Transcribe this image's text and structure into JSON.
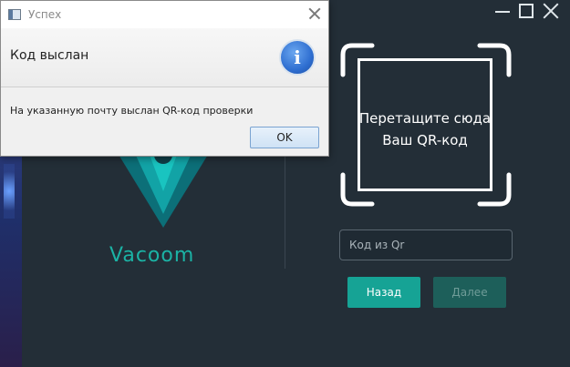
{
  "dialog": {
    "title": "Успех",
    "header": "Код выслан",
    "message": "На указанную почту выслан QR-код проверки",
    "ok_label": "OK",
    "icon": "info-icon"
  },
  "app": {
    "logo_text": "Vacoom",
    "qr_drop_line1": "Перетащите сюда",
    "qr_drop_line2": "Ваш QR-код",
    "code_input": {
      "value": "",
      "placeholder": "Код из Qr"
    },
    "back_label": "Назад",
    "next_label": "Далее"
  },
  "colors": {
    "accent": "#16a395",
    "background": "#232e37"
  }
}
